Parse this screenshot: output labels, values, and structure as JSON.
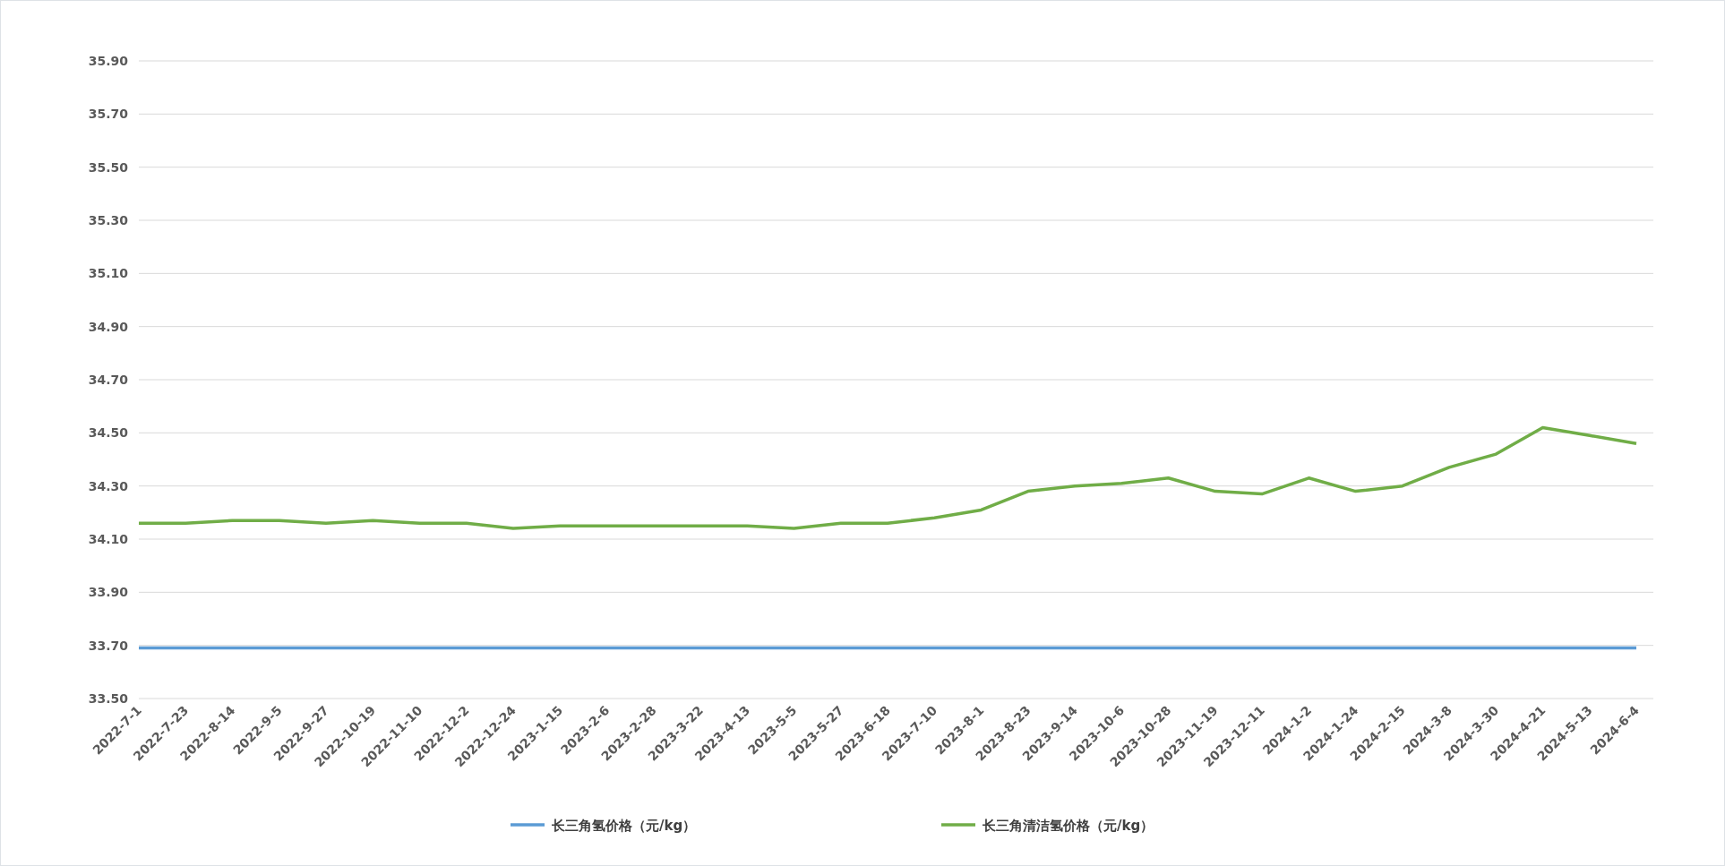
{
  "chart": {
    "chart_data": {
      "type": "line",
      "categories": [
        "2022-7-1",
        "2022-7-23",
        "2022-8-14",
        "2022-9-5",
        "2022-9-27",
        "2022-10-19",
        "2022-11-10",
        "2022-12-2",
        "2022-12-24",
        "2023-1-15",
        "2023-2-6",
        "2023-2-28",
        "2023-3-22",
        "2023-4-13",
        "2023-5-5",
        "2023-5-27",
        "2023-6-18",
        "2023-7-10",
        "2023-8-1",
        "2023-8-23",
        "2023-9-14",
        "2023-10-6",
        "2023-10-28",
        "2023-11-19",
        "2023-12-11",
        "2024-1-2",
        "2024-1-24",
        "2024-2-15",
        "2024-3-8",
        "2024-3-30",
        "2024-4-21",
        "2024-5-13",
        "2024-6-4"
      ],
      "series": [
        {
          "name": "长三角氢价格（元/kg）",
          "color": "#5b9bd5",
          "values": [
            33.69,
            33.69,
            33.69,
            33.69,
            33.69,
            33.69,
            33.69,
            33.69,
            33.69,
            33.69,
            33.69,
            33.69,
            33.69,
            33.69,
            33.69,
            33.69,
            33.69,
            33.69,
            33.69,
            33.69,
            33.69,
            33.69,
            33.69,
            33.69,
            33.69,
            33.69,
            33.69,
            33.69,
            33.69,
            33.69,
            33.69,
            33.69,
            33.69
          ]
        },
        {
          "name": "长三角清洁氢价格（元/kg）",
          "color": "#70ad47",
          "values": [
            34.16,
            34.16,
            34.17,
            34.17,
            34.16,
            34.17,
            34.16,
            34.16,
            34.14,
            34.15,
            34.15,
            34.15,
            34.15,
            34.15,
            34.14,
            34.16,
            34.16,
            34.18,
            34.21,
            34.28,
            34.3,
            34.31,
            34.33,
            34.28,
            34.27,
            34.33,
            34.28,
            34.3,
            34.37,
            34.42,
            34.52,
            34.49,
            34.46
          ]
        }
      ],
      "ylim": [
        33.5,
        35.9
      ],
      "grid": true,
      "legend": true,
      "yticks": [
        {
          "value": 33.5,
          "label": "33.50"
        },
        {
          "value": 33.7,
          "label": "33.70"
        },
        {
          "value": 33.9,
          "label": "33.90"
        },
        {
          "value": 34.1,
          "label": "34.10"
        },
        {
          "value": 34.3,
          "label": "34.30"
        },
        {
          "value": 34.5,
          "label": "34.50"
        },
        {
          "value": 34.7,
          "label": "34.70"
        },
        {
          "value": 34.9,
          "label": "34.90"
        },
        {
          "value": 35.1,
          "label": "35.10"
        },
        {
          "value": 35.3,
          "label": "35.30"
        },
        {
          "value": 35.5,
          "label": "35.50"
        },
        {
          "value": 35.7,
          "label": "35.70"
        },
        {
          "value": 35.9,
          "label": "35.90"
        }
      ]
    }
  }
}
